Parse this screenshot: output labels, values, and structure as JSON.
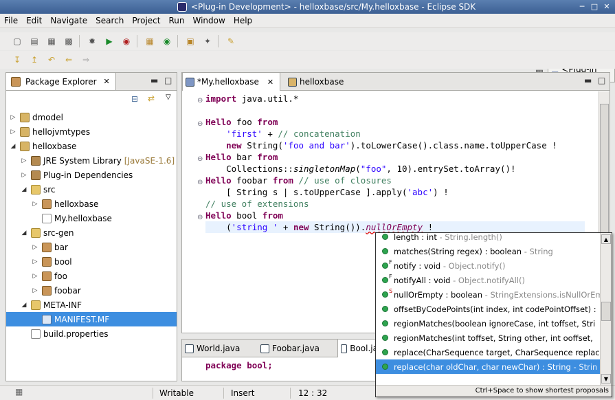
{
  "window": {
    "title": "<Plug-in Development> - helloxbase/src/My.helloxbase - Eclipse SDK"
  },
  "menu": [
    "File",
    "Edit",
    "Navigate",
    "Search",
    "Project",
    "Run",
    "Window",
    "Help"
  ],
  "perspective": {
    "label": "<Plug-in De..."
  },
  "explorer": {
    "tab_label": "Package Explorer",
    "items": [
      {
        "label": "dmodel",
        "suffix": "",
        "level": 0,
        "twisty": "closed",
        "icon": "project-icon"
      },
      {
        "label": "hellojvmtypes",
        "suffix": "",
        "level": 0,
        "twisty": "closed",
        "icon": "project-icon"
      },
      {
        "label": "helloxbase",
        "suffix": "",
        "level": 0,
        "twisty": "open",
        "icon": "project-icon"
      },
      {
        "label": "JRE System Library",
        "suffix": "[JavaSE-1.6]",
        "level": 1,
        "twisty": "closed",
        "icon": "library-icon"
      },
      {
        "label": "Plug-in Dependencies",
        "suffix": "",
        "level": 1,
        "twisty": "closed",
        "icon": "library-icon"
      },
      {
        "label": "src",
        "suffix": "",
        "level": 1,
        "twisty": "open",
        "icon": "folder-icon"
      },
      {
        "label": "helloxbase",
        "suffix": "",
        "level": 2,
        "twisty": "closed",
        "icon": "package-icon"
      },
      {
        "label": "My.helloxbase",
        "suffix": "",
        "level": 2,
        "twisty": "none",
        "icon": "file-icon"
      },
      {
        "label": "src-gen",
        "suffix": "",
        "level": 1,
        "twisty": "open",
        "icon": "folder-icon"
      },
      {
        "label": "bar",
        "suffix": "",
        "level": 2,
        "twisty": "closed",
        "icon": "package-icon"
      },
      {
        "label": "bool",
        "suffix": "",
        "level": 2,
        "twisty": "closed",
        "icon": "package-icon"
      },
      {
        "label": "foo",
        "suffix": "",
        "level": 2,
        "twisty": "closed",
        "icon": "package-icon"
      },
      {
        "label": "foobar",
        "suffix": "",
        "level": 2,
        "twisty": "closed",
        "icon": "package-icon"
      },
      {
        "label": "META-INF",
        "suffix": "",
        "level": 1,
        "twisty": "open",
        "icon": "folder-icon"
      },
      {
        "label": "MANIFEST.MF",
        "suffix": "",
        "level": 2,
        "twisty": "none",
        "icon": "manifest-icon",
        "selected": true
      },
      {
        "label": "build.properties",
        "suffix": "",
        "level": 1,
        "twisty": "none",
        "icon": "file-icon"
      }
    ]
  },
  "editor": {
    "tabs": [
      {
        "label": "*My.helloxbase",
        "active": true
      },
      {
        "label": "helloxbase",
        "active": false
      }
    ],
    "code_lines": [
      "import java.util.*",
      "",
      "Hello foo from",
      "    'first' + // concatenation",
      "    new String('foo and bar').toLowerCase().class.name.toUpperCase !",
      "Hello bar from",
      "    Collections::singletonMap(\"foo\", 10).entrySet.toArray()!",
      "Hello foobar from // use of closures",
      "    [ String s | s.toUpperCase ].apply('abc') !",
      "// use of extensions",
      "Hello bool from",
      "    ('string ' + new String()).nullOrEmpty !"
    ]
  },
  "bottom_tabs": [
    {
      "label": "World.java"
    },
    {
      "label": "Foobar.java"
    },
    {
      "label": "Bool.ja"
    }
  ],
  "bottom_code": "package bool;",
  "completion": {
    "proposals": [
      {
        "main": "length : int",
        "detail": " - String.length()",
        "mark": ""
      },
      {
        "main": "matches(String regex) : boolean",
        "detail": " - String",
        "mark": ""
      },
      {
        "main": "notify : void",
        "detail": " - Object.notify()",
        "mark": "F"
      },
      {
        "main": "notifyAll : void",
        "detail": " - Object.notifyAll()",
        "mark": "F"
      },
      {
        "main": "nullOrEmpty : boolean",
        "detail": " - StringExtensions.isNullOrEm",
        "mark": "S"
      },
      {
        "main": "offsetByCodePoints(int index, int codePointOffset) :",
        "detail": "",
        "mark": ""
      },
      {
        "main": "regionMatches(boolean ignoreCase, int toffset, Stri",
        "detail": "",
        "mark": ""
      },
      {
        "main": "regionMatches(int toffset, String other, int ooffset,",
        "detail": "",
        "mark": ""
      },
      {
        "main": "replace(CharSequence target, CharSequence replac",
        "detail": "",
        "mark": ""
      },
      {
        "main": "replace(char oldChar, char newChar) : String",
        "detail": " - Strin",
        "mark": "",
        "selected": true
      }
    ],
    "footer": "Ctrl+Space to show shortest proposals"
  },
  "status": {
    "mode": "Writable",
    "insert": "Insert",
    "position": "12 : 32"
  }
}
